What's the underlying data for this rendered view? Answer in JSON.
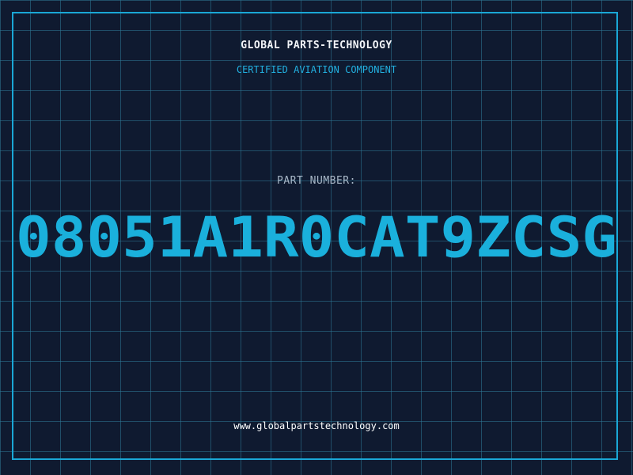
{
  "header": {
    "brand": "GLOBAL PARTS-TECHNOLOGY",
    "subtitle": "CERTIFIED AVIATION COMPONENT"
  },
  "part": {
    "label": "PART NUMBER:",
    "number": "08051A1R0CAT9ZCSG"
  },
  "footer": {
    "url": "www.globalpartstechnology.com"
  },
  "colors": {
    "background": "#0f1a30",
    "grid": "#2d7896",
    "frame": "#1aa7d6",
    "accent": "#22b0e0",
    "part_number": "#1ab0dc"
  }
}
